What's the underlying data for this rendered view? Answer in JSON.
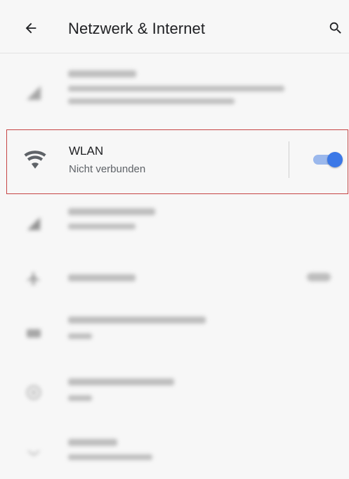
{
  "toolbar": {
    "title": "Netzwerk & Internet",
    "back_icon": "arrow-back-icon",
    "search_icon": "search-icon"
  },
  "wlan": {
    "title": "WLAN",
    "subtitle": "Nicht verbunden",
    "icon": "wifi-icon",
    "toggle_on": true,
    "accent_color": "#3b78e7",
    "highlight_color": "#c64545"
  },
  "blurred_items": [
    {
      "name": "mobile-network",
      "icon": "signal-icon"
    },
    {
      "name": "mobile-data",
      "icon": "signal-icon"
    },
    {
      "name": "airplane-mode",
      "icon": "airplane-icon"
    },
    {
      "name": "hotspot-tethering",
      "icon": "hotspot-icon"
    },
    {
      "name": "data-saver",
      "icon": "data-saver-icon"
    },
    {
      "name": "advanced",
      "icon": "expand-icon"
    }
  ]
}
